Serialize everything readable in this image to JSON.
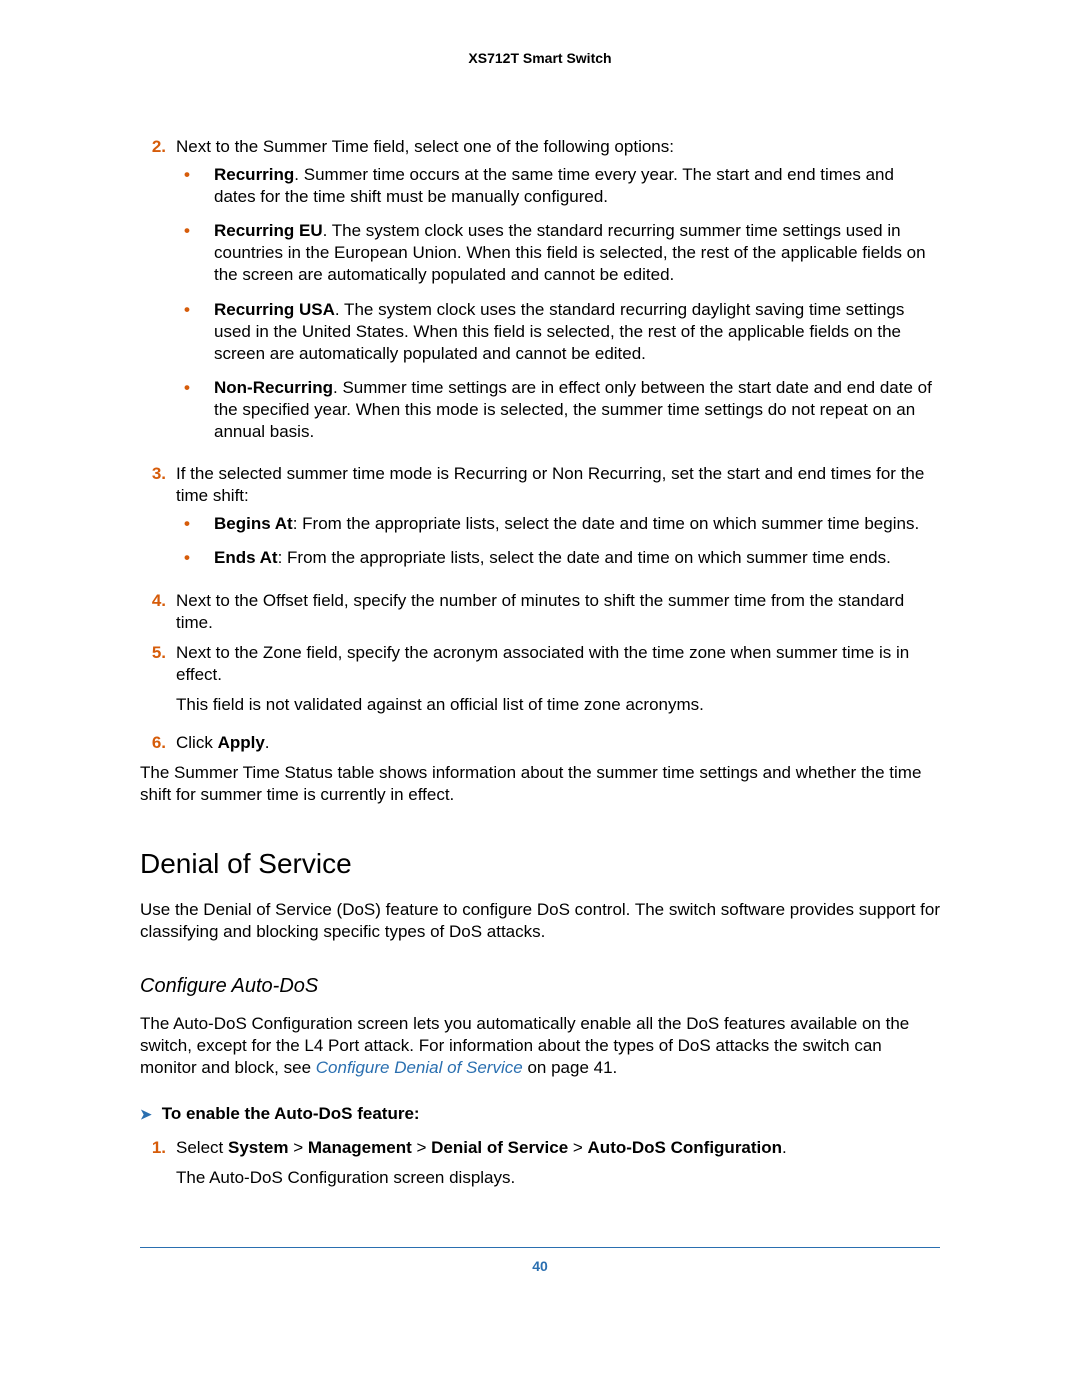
{
  "header": "XS712T Smart Switch",
  "step2": {
    "num": "2.",
    "text": "Next to the Summer Time field, select one of the following options:",
    "bullets": [
      {
        "label": "Recurring",
        "text": ". Summer time occurs at the same time every year. The start and end times and dates for the time shift must be manually configured."
      },
      {
        "label": "Recurring EU",
        "text": ". The system clock uses the standard recurring summer time settings used in countries in the European Union. When this field is selected, the rest of the applicable fields on the screen are automatically populated and cannot be edited."
      },
      {
        "label": "Recurring USA",
        "text": ". The system clock uses the standard recurring daylight saving time settings used in the United States. When this field is selected, the rest of the applicable fields on the screen are automatically populated and cannot be edited."
      },
      {
        "label": "Non-Recurring",
        "text": ". Summer time settings are in effect only between the start date and end date of the specified year. When this mode is selected, the summer time settings do not repeat on an annual basis."
      }
    ]
  },
  "step3": {
    "num": "3.",
    "text": "If the selected summer time mode is Recurring or Non Recurring, set the start and end times for the time shift:",
    "bullets": [
      {
        "label": "Begins At",
        "text": ": From the appropriate lists, select the date and time on which summer time begins."
      },
      {
        "label": "Ends At",
        "text": ": From the appropriate lists, select the date and time on which summer time ends."
      }
    ]
  },
  "step4": {
    "num": "4.",
    "text": "Next to the Offset field, specify the number of minutes to shift the summer time from the standard time."
  },
  "step5": {
    "num": "5.",
    "text": "Next to the Zone field, specify the acronym associated with the time zone when summer time is in effect.",
    "extra": "This field is not validated against an official list of time zone acronyms."
  },
  "step6": {
    "num": "6.",
    "pre": "Click ",
    "bold": "Apply",
    "post": "."
  },
  "summary": "The Summer Time Status table shows information about the summer time settings and whether the time shift for summer time is currently in effect.",
  "dos": {
    "heading": "Denial of Service",
    "intro": "Use the Denial of Service (DoS) feature to configure DoS control. The switch software provides support for classifying and blocking specific types of DoS attacks.",
    "sub": "Configure Auto-DoS",
    "sub_intro_a": "The Auto-DoS Configuration screen lets you automatically enable all the DoS features available on the switch, except for the L4 Port attack. For information about the types of DoS attacks the switch can monitor and block, see ",
    "sub_link": "Configure Denial of Service",
    "sub_intro_b": " on page 41.",
    "proc_head": "To enable the Auto-DoS feature:",
    "step1": {
      "num": "1.",
      "pre": "Select ",
      "b1": "System",
      "s1": " > ",
      "b2": "Management",
      "s2": " > ",
      "b3": "Denial of Service",
      "s3": " > ",
      "b4": "Auto-DoS Configuration",
      "post": ".",
      "after": "The Auto-DoS Configuration screen displays."
    }
  },
  "page_number": "40"
}
